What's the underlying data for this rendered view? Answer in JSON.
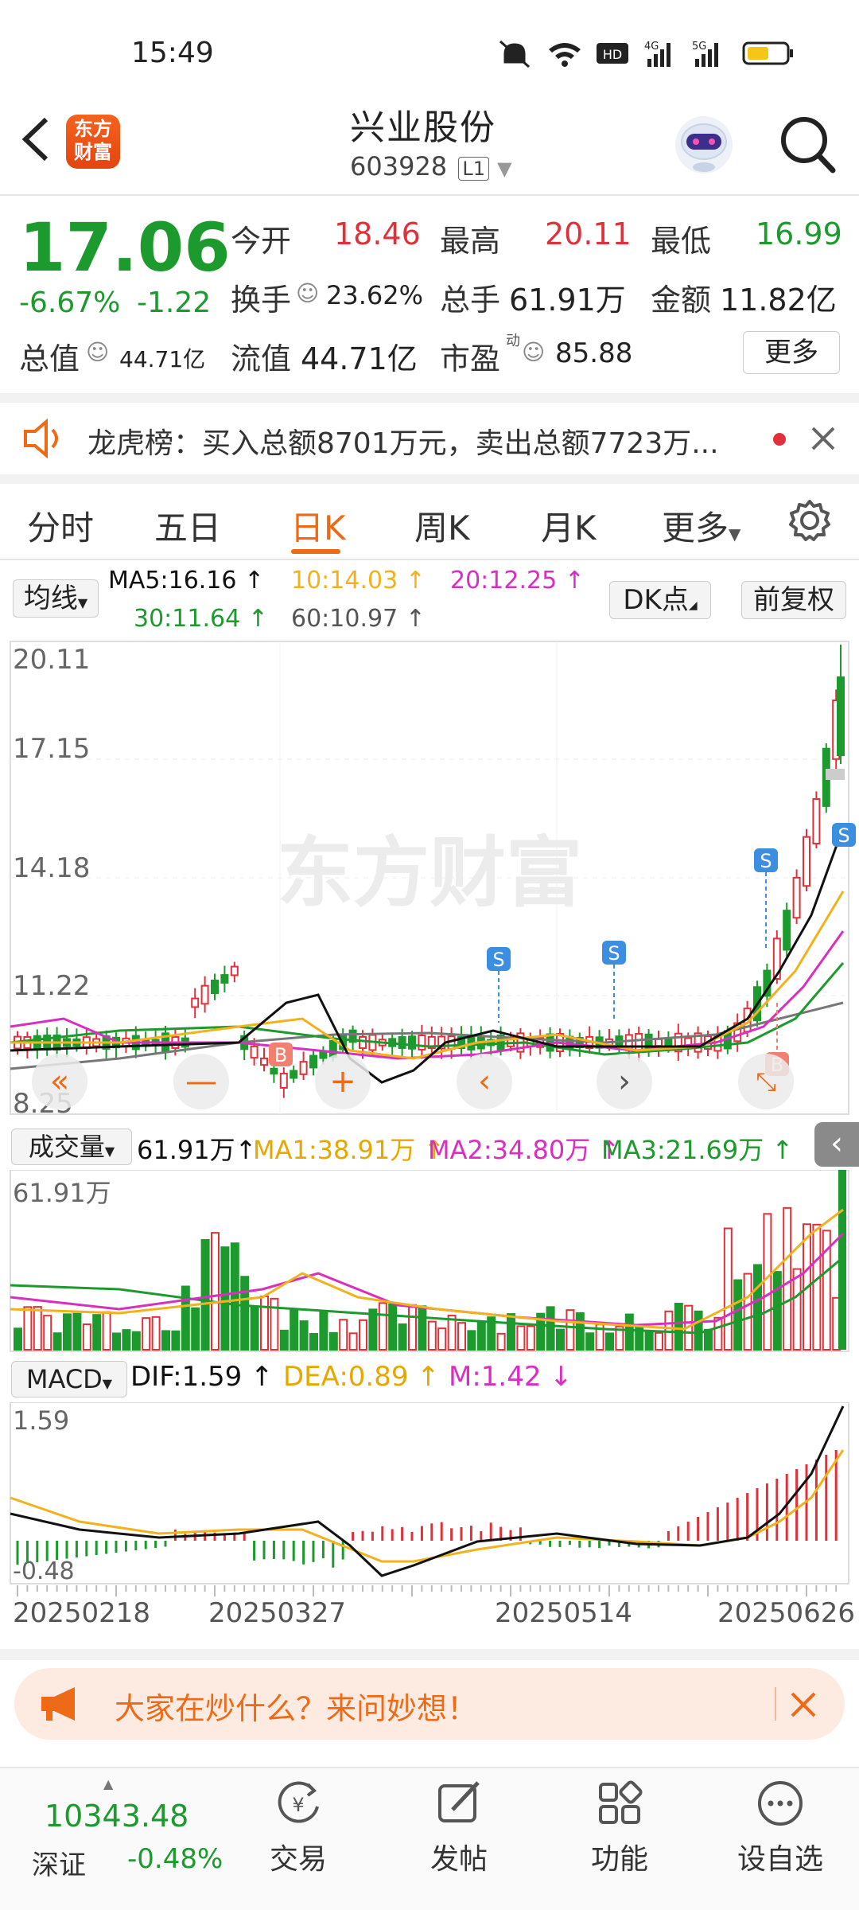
{
  "status_bar": {
    "time": "15:49",
    "hd_label": "HD"
  },
  "header": {
    "brand_line1": "东方",
    "brand_line2": "财富",
    "stock_name": "兴业股份",
    "stock_code": "603928",
    "level_badge": "L1"
  },
  "quote": {
    "price": "17.06",
    "change_pct": "-6.67%",
    "change_abs": "-1.22",
    "open_label": "今开",
    "open": "18.46",
    "high_label": "最高",
    "high": "20.11",
    "low_label": "最低",
    "low": "16.99",
    "turnover_label": "换手",
    "turnover": "23.62%",
    "volume_label": "总手",
    "volume": "61.91万",
    "amount_label": "金额",
    "amount": "11.82亿",
    "total_mv_label": "总值",
    "total_mv": "44.71亿",
    "float_mv_label": "流值",
    "float_mv": "44.71亿",
    "pe_label": "市盈",
    "pe_sup": "动",
    "pe": "85.88",
    "more_label": "更多"
  },
  "notice": {
    "text": "龙虎榜：买入总额8701万元，卖出总额7723万..."
  },
  "tabs": [
    {
      "label": "分时"
    },
    {
      "label": "五日"
    },
    {
      "label": "日K"
    },
    {
      "label": "周K"
    },
    {
      "label": "月K"
    },
    {
      "label": "更多"
    }
  ],
  "ma": {
    "selector": "均线",
    "ma5": "MA5:16.16",
    "ma10": "10:14.03",
    "ma20": "20:12.25",
    "ma30": "30:11.64",
    "ma60": "60:10.97",
    "dk_label": "DK点",
    "adjust_label": "前复权"
  },
  "kline": {
    "y_labels": [
      "20.11",
      "17.15",
      "14.18",
      "11.22",
      "8.25"
    ],
    "watermark": "东方财富",
    "markers": [
      "S",
      "S",
      "S",
      "S",
      "B",
      "B"
    ]
  },
  "volume": {
    "selector": "成交量",
    "value": "61.91万",
    "ma1": "MA1:38.91万",
    "ma2": "MA2:34.80万",
    "ma3": "MA3:21.69万",
    "top_label": "61.91万"
  },
  "macd": {
    "selector": "MACD",
    "dif": "DIF:1.59",
    "dea": "DEA:0.89",
    "m": "M:1.42",
    "top_label": "1.59",
    "bottom_label": "-0.48"
  },
  "dates": [
    "20250218",
    "20250327",
    "20250514",
    "20250626"
  ],
  "ask_bar": {
    "text": "大家在炒什么？来问妙想！"
  },
  "bottom_nav": {
    "index_value": "10343.48",
    "index_name": "深证",
    "index_change": "-0.48%",
    "items": [
      {
        "label": "交易"
      },
      {
        "label": "发帖"
      },
      {
        "label": "功能"
      },
      {
        "label": "设自选"
      }
    ]
  },
  "colors": {
    "up": "#e0313b",
    "down": "#1d9a2e",
    "accent": "#ee6a16",
    "ma5": "#111111",
    "ma10": "#f2b21d",
    "ma20": "#d82fc0",
    "ma30": "#1d9a2e",
    "ma60": "#777777"
  }
}
